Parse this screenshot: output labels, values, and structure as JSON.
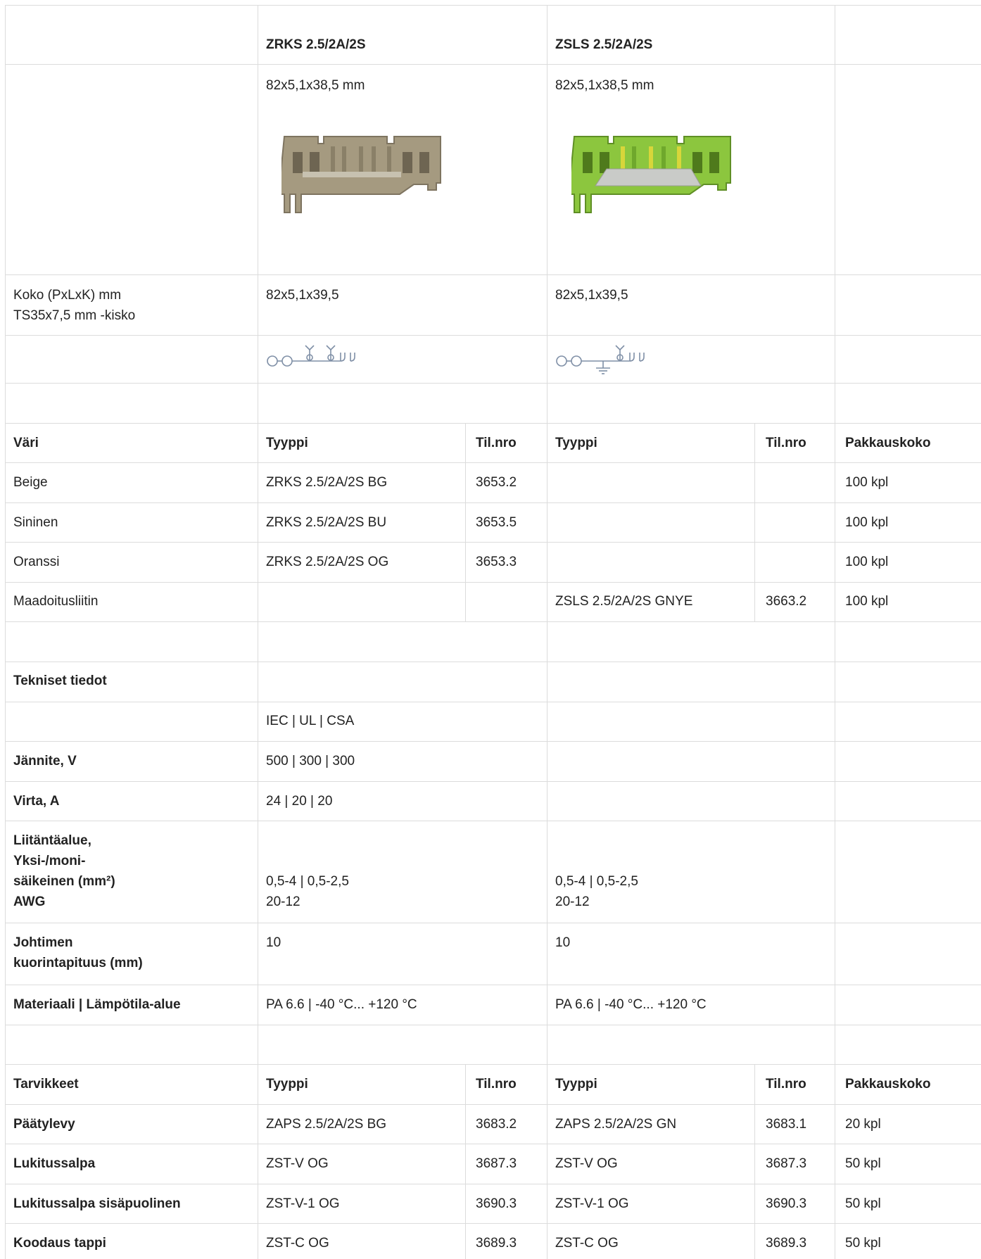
{
  "products": [
    {
      "name": "ZRKS 2.5/2A/2S",
      "dims": "82x5,1x38,5 mm",
      "size": "82x5,1x39,5",
      "image": "beige-terminal-block-image",
      "color": "#a59a80"
    },
    {
      "name": "ZSLS 2.5/2A/2S",
      "dims": "82x5,1x38,5 mm",
      "size": "82x5,1x39,5",
      "image": "green-yellow-terminal-block-image",
      "color": "#8cc63e"
    }
  ],
  "size_label": "Koko (PxLxK) mm\nTS35x7,5 mm -kisko",
  "order_header": {
    "col1": "Väri",
    "type": "Tyyppi",
    "nro": "Til.nro",
    "pack": "Pakkauskoko"
  },
  "order_rows": [
    {
      "label": "Beige",
      "type1": "ZRKS 2.5/2A/2S BG",
      "nro1": "3653.2",
      "type2": "",
      "nro2": "",
      "pack": "100 kpl"
    },
    {
      "label": "Sininen",
      "type1": "ZRKS 2.5/2A/2S BU",
      "nro1": "3653.5",
      "type2": "",
      "nro2": "",
      "pack": "100 kpl"
    },
    {
      "label": "Oranssi",
      "type1": "ZRKS 2.5/2A/2S OG",
      "nro1": "3653.3",
      "type2": "",
      "nro2": "",
      "pack": "100 kpl"
    },
    {
      "label": "Maadoitusliitin",
      "type1": "",
      "nro1": "",
      "type2": "ZSLS 2.5/2A/2S GNYE",
      "nro2": "3663.2",
      "pack": "100 kpl"
    }
  ],
  "tech": {
    "title": "Tekniset tiedot",
    "standards": "IEC | UL | CSA",
    "voltage_label": "Jännite, V",
    "voltage": "500 | 300 | 300",
    "current_label": "Virta, A",
    "current": "24 | 20 | 20",
    "area_label": "Liitäntäalue,\nYksi-/moni-\nsäikeinen (mm²)\nAWG",
    "area1": "0,5-4 | 0,5-2,5\n20-12",
    "area2": "0,5-4 | 0,5-2,5\n20-12",
    "strip_label": "Johtimen\nkuorintapituus (mm)",
    "strip1": "10",
    "strip2": "10",
    "material_label": "Materiaali | Lämpötila-alue",
    "material1": "PA 6.6 | -40 °C... +120 °C",
    "material2": "PA 6.6 | -40 °C... +120 °C"
  },
  "acc_header": {
    "col1": "Tarvikkeet",
    "type": "Tyyppi",
    "nro": "Til.nro",
    "pack": "Pakkauskoko"
  },
  "acc_rows": [
    {
      "label": "Päätylevy",
      "type1": "ZAPS 2.5/2A/2S BG",
      "nro1": "3683.2",
      "type2": "ZAPS 2.5/2A/2S GN",
      "nro2": "3683.1",
      "pack": "20 kpl"
    },
    {
      "label": "Lukitussalpa",
      "type1": "ZST-V OG",
      "nro1": "3687.3",
      "type2": "ZST-V OG",
      "nro2": "3687.3",
      "pack": "50 kpl"
    },
    {
      "label": "Lukitussalpa sisäpuolinen",
      "type1": "ZST-V-1 OG",
      "nro1": "3690.3",
      "type2": "ZST-V-1 OG",
      "nro2": "3690.3",
      "pack": "50 kpl"
    },
    {
      "label": "Koodaus tappi",
      "type1": "ZST-C OG",
      "nro1": "3689.3",
      "type2": "ZST-C OG",
      "nro2": "3689.3",
      "pack": "50 kpl"
    }
  ],
  "icons": {
    "symbol1": "terminal-schematic-icon",
    "symbol2": "ground-terminal-schematic-icon"
  }
}
